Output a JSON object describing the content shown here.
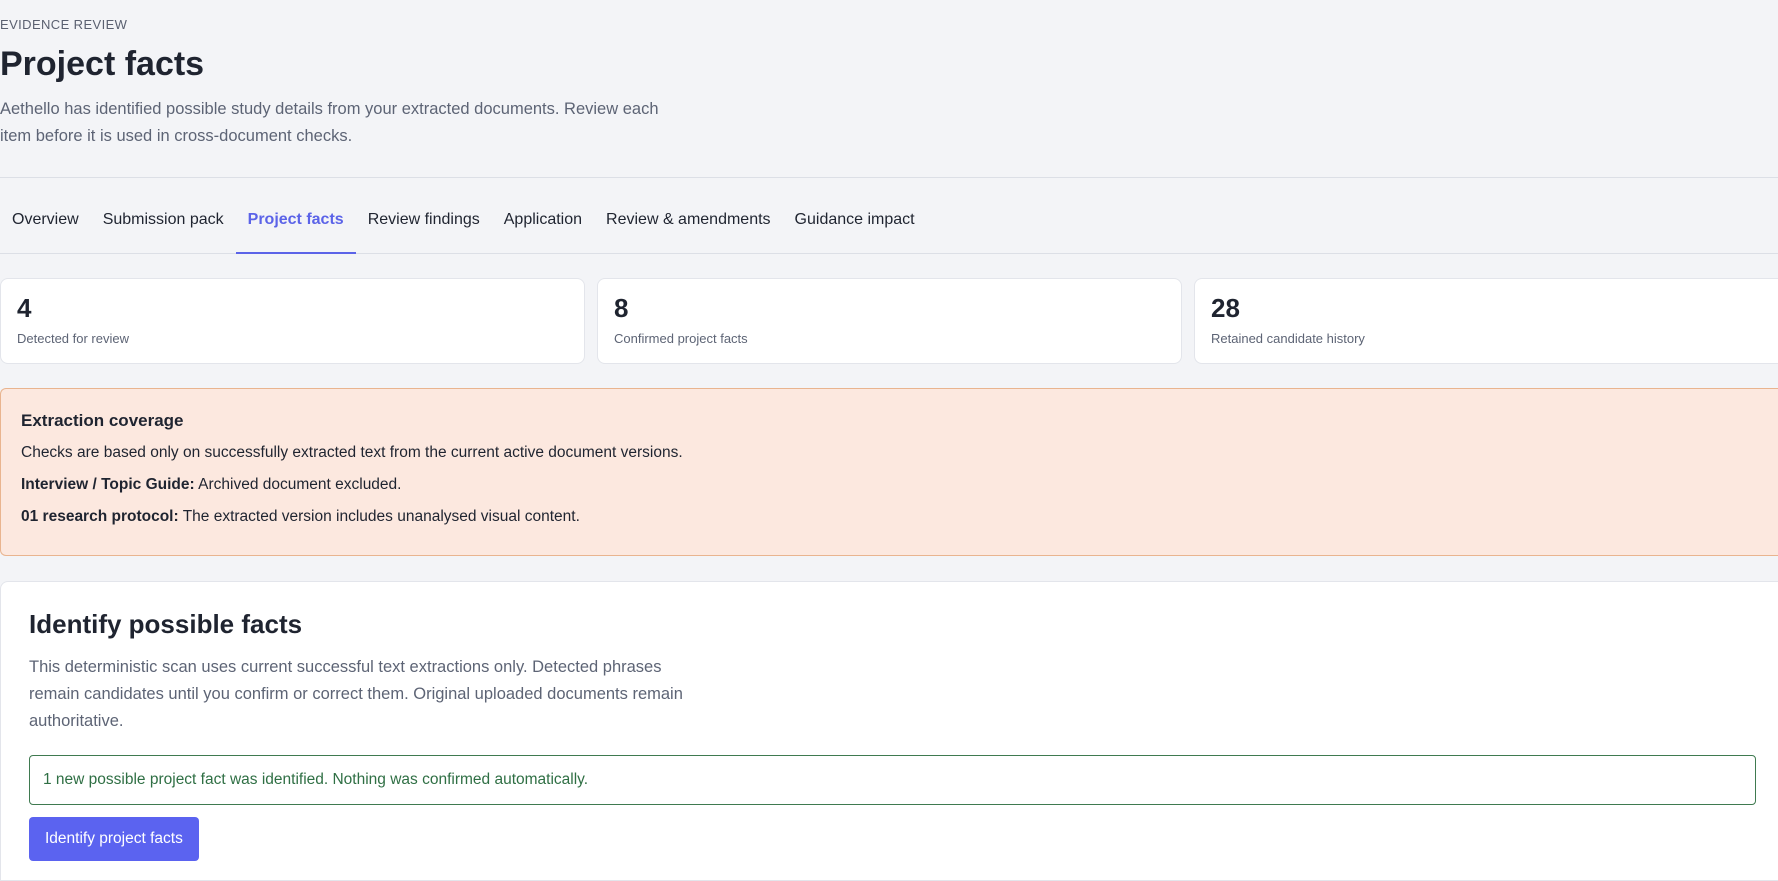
{
  "header": {
    "eyebrow": "EVIDENCE REVIEW",
    "title": "Project facts",
    "description": "Aethello has identified possible study details from your extracted documents. Review each item before it is used in cross-document checks."
  },
  "tabs": [
    {
      "label": "Overview"
    },
    {
      "label": "Submission pack"
    },
    {
      "label": "Project facts",
      "active": true
    },
    {
      "label": "Review findings"
    },
    {
      "label": "Application"
    },
    {
      "label": "Review & amendments"
    },
    {
      "label": "Guidance impact"
    }
  ],
  "stats": [
    {
      "value": "4",
      "label": "Detected for review"
    },
    {
      "value": "8",
      "label": "Confirmed project facts"
    },
    {
      "value": "28",
      "label": "Retained candidate history"
    }
  ],
  "coverage": {
    "title": "Extraction coverage",
    "intro": "Checks are based only on successfully extracted text from the current active document versions.",
    "items": [
      {
        "label": "Interview / Topic Guide:",
        "text": "Archived document excluded."
      },
      {
        "label": "01 research protocol:",
        "text": "The extracted version includes unanalysed visual content."
      }
    ]
  },
  "identify": {
    "title": "Identify possible facts",
    "description": "This deterministic scan uses current successful text extractions only. Detected phrases remain candidates until you confirm or correct them. Original uploaded documents remain authoritative.",
    "notice": "1 new possible project fact was identified. Nothing was confirmed automatically.",
    "button_label": "Identify project facts"
  },
  "colors": {
    "accent": "#5b63e8",
    "warning_bg": "#fce8df",
    "success_text": "#2f6f44"
  }
}
